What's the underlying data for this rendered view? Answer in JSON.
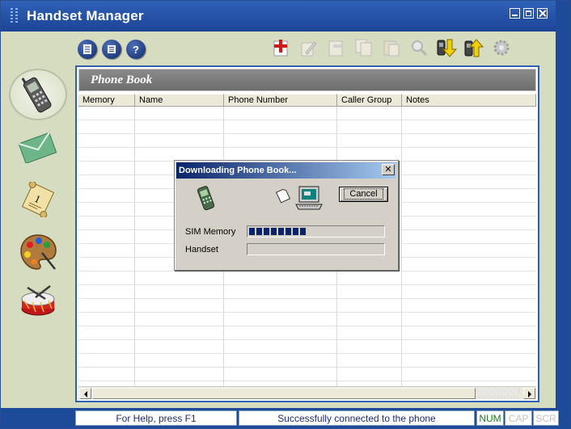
{
  "app": {
    "title": "Handset Manager"
  },
  "window_controls": [
    "minimize",
    "maximize",
    "close"
  ],
  "toolbar": {
    "left": [
      {
        "name": "document-icon",
        "glyph": "▤"
      },
      {
        "name": "list-icon",
        "glyph": "☰"
      },
      {
        "name": "help-icon",
        "glyph": "?"
      }
    ],
    "right": [
      "add-entry-icon",
      "edit-icon",
      "rename-icon",
      "copy-icon",
      "paste-icon",
      "find-icon",
      "download-from-phone-icon",
      "upload-to-phone-icon",
      "settings-icon"
    ]
  },
  "nav": [
    "phone-book",
    "messages",
    "memo",
    "paint-palette",
    "ringtones-drum"
  ],
  "panel": {
    "title": "Phone Book",
    "columns": [
      {
        "label": "Memory",
        "w": 70
      },
      {
        "label": "Name",
        "w": 110
      },
      {
        "label": "Phone Number",
        "w": 140
      },
      {
        "label": "Caller Group",
        "w": 80
      },
      {
        "label": "Notes",
        "w": 166
      }
    ]
  },
  "dialog": {
    "title": "Downloading Phone Book...",
    "cancel_label": "Cancel",
    "sim_label": "SIM Memory",
    "handset_label": "Handset",
    "sim_progress": 0.43,
    "handset_progress": 0.0
  },
  "status": {
    "help": "For Help, press F1",
    "connection": "Successfully connected to the phone",
    "num": "NUM",
    "cap": "CAP",
    "scr": "SCR"
  },
  "colors": {
    "title_bar": "#1c4496",
    "accent": "#2e5fb0",
    "progress": "#0a246a",
    "num_active": "#1d7a1d"
  }
}
